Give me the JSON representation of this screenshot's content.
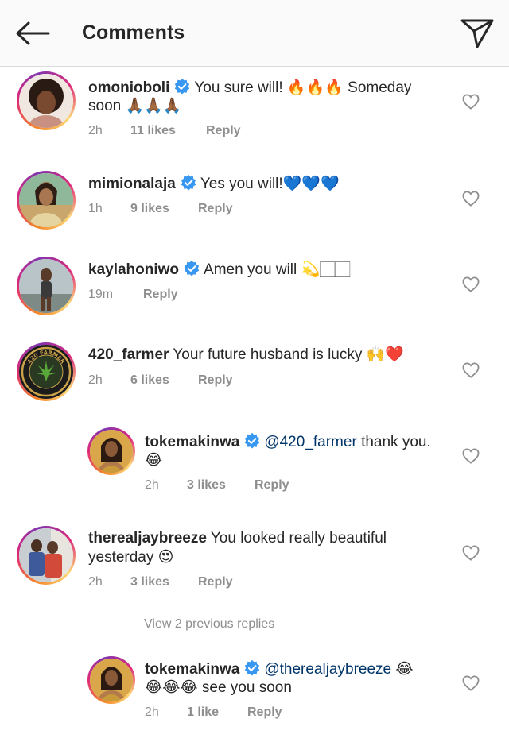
{
  "header": {
    "title": "Comments",
    "back_icon": "arrow-left-icon",
    "send_icon": "paper-plane-icon"
  },
  "comments": [
    {
      "username": "omonioboli",
      "verified": true,
      "text_line1": "You sure will! 🔥🔥🔥 Someday",
      "text_line2": "soon 🙏🏾🙏🏾🙏🏾",
      "time": "2h",
      "likes": "11 likes",
      "reply": "Reply"
    },
    {
      "username": "mimionalaja",
      "verified": true,
      "text_line1": "Yes you will!💙💙💙",
      "time": "1h",
      "likes": "9 likes",
      "reply": "Reply"
    },
    {
      "username": "kaylahoniwo",
      "verified": true,
      "text_line1": "Amen  you will 💫🏻🏻",
      "time": "19m",
      "likes": "",
      "reply": "Reply"
    },
    {
      "username": "420_farmer",
      "verified": false,
      "text_line1": "Your future husband is lucky 🙌❤️",
      "time": "2h",
      "likes": "6 likes",
      "reply": "Reply",
      "avatar_text": "420 FARMER"
    },
    {
      "username": "tokemakinwa",
      "verified": true,
      "mention": "@420_farmer",
      "text_line1": "thank you.",
      "text_line2": "😂",
      "time": "2h",
      "likes": "3 likes",
      "reply": "Reply"
    },
    {
      "username": "therealjaybreeze",
      "verified": false,
      "text_line1": "You looked really beautiful",
      "text_line2": "yesterday 😍",
      "time": "2h",
      "likes": "3 likes",
      "reply": "Reply"
    },
    {
      "username": "tokemakinwa",
      "verified": true,
      "mention": "@therealjaybreeze",
      "text_line1": "😂",
      "text_line2": "😂😂😂 see you soon",
      "time": "2h",
      "likes": "1 like",
      "reply": "Reply"
    }
  ],
  "view_previous_replies": "View 2 previous replies",
  "colors": {
    "verified_blue": "#3897f0",
    "heart_outline": "#8e8e8e",
    "ring_gradient": [
      "#f58529",
      "#dd2a7b",
      "#8134af",
      "#feda77"
    ]
  }
}
